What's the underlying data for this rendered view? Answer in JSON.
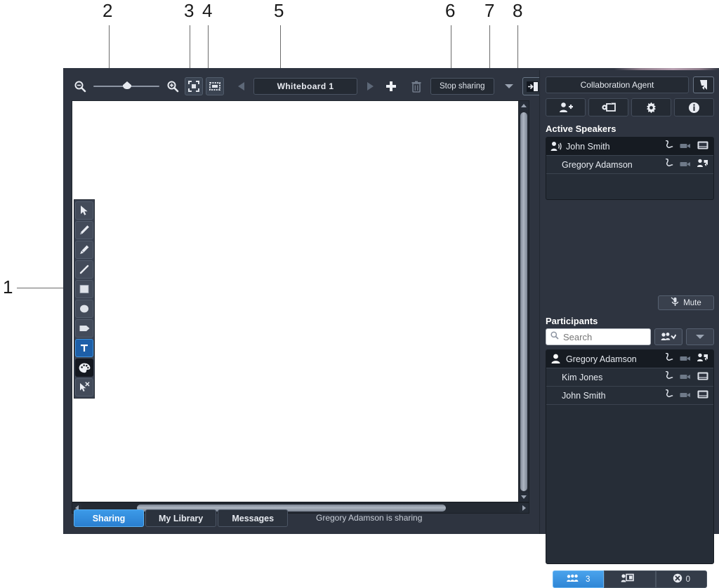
{
  "callouts": [
    {
      "num": "1"
    },
    {
      "num": "2"
    },
    {
      "num": "3"
    },
    {
      "num": "4"
    },
    {
      "num": "5"
    },
    {
      "num": "6"
    },
    {
      "num": "7"
    },
    {
      "num": "8"
    }
  ],
  "whiteboard_toolbar": {
    "zoom_out_icon": "magnifier-minus-icon",
    "zoom_in_icon": "magnifier-plus-icon",
    "fit_page_icon": "fit-to-page-icon",
    "fit_width_icon": "fit-to-width-icon",
    "prev_icon": "previous-page-icon",
    "next_icon": "next-page-icon",
    "add_icon": "add-page-icon",
    "delete_icon": "trash-icon",
    "title_value": "Whiteboard 1",
    "stop_sharing_label": "Stop sharing",
    "dropdown_icon": "chevron-down-icon",
    "dock_icon": "dock-panel-icon"
  },
  "tools": [
    {
      "name": "select-tool",
      "icon": "arrow-cursor-icon",
      "selected": false
    },
    {
      "name": "pencil-tool",
      "icon": "pencil-icon",
      "selected": false
    },
    {
      "name": "highlighter-tool",
      "icon": "marker-icon",
      "selected": false
    },
    {
      "name": "line-tool",
      "icon": "line-icon",
      "selected": false
    },
    {
      "name": "rectangle-tool",
      "icon": "rectangle-icon",
      "selected": false
    },
    {
      "name": "ellipse-tool",
      "icon": "ellipse-icon",
      "selected": false
    },
    {
      "name": "arrow-shape-tool",
      "icon": "arrow-shape-icon",
      "selected": false
    },
    {
      "name": "text-tool",
      "icon": "text-T-icon",
      "selected": true
    },
    {
      "name": "color-palette-tool",
      "icon": "palette-icon",
      "selected": false
    },
    {
      "name": "eraser-tool",
      "icon": "cursor-delete-icon",
      "selected": false
    }
  ],
  "bottom_tabs": {
    "items": [
      {
        "label": "Sharing",
        "active": true
      },
      {
        "label": "My Library",
        "active": false
      },
      {
        "label": "Messages",
        "active": false
      }
    ],
    "status": "Gregory Adamson is sharing"
  },
  "right_panel": {
    "title": "Collaboration Agent",
    "undock_icon": "undock-arrow-icon",
    "actions": [
      {
        "name": "add-participant-button",
        "icon": "person-plus-icon"
      },
      {
        "name": "share-screen-button",
        "icon": "share-settings-icon"
      },
      {
        "name": "settings-button",
        "icon": "gear-icon"
      },
      {
        "name": "info-button",
        "icon": "info-circle-icon"
      }
    ],
    "active_speakers": {
      "heading": "Active Speakers",
      "rows": [
        {
          "name": "John Smith",
          "highlighted": true,
          "avatar": "person-speaking-icon",
          "icons": [
            "phone-icon",
            "video-icon",
            "screen-icon"
          ]
        },
        {
          "name": "Gregory Adamson",
          "highlighted": false,
          "avatar": "",
          "icons": [
            "phone-icon",
            "video-icon",
            "person-share-icon"
          ]
        }
      ]
    },
    "mute": {
      "label": "Mute",
      "icon": "microphone-muted-icon"
    },
    "participants": {
      "heading": "Participants",
      "search_placeholder": "Search",
      "search_value": "",
      "search_icon": "search-icon",
      "invite_icon": "invite-people-icon",
      "dropdown_icon": "chevron-down-icon",
      "rows": [
        {
          "name": "Gregory Adamson",
          "highlighted": true,
          "avatar": "person-filled-icon",
          "icons": [
            "phone-icon",
            "video-icon",
            "person-share-icon"
          ]
        },
        {
          "name": "Kim Jones",
          "highlighted": false,
          "avatar": "",
          "icons": [
            "phone-icon",
            "video-icon",
            "screen-icon"
          ]
        },
        {
          "name": "John Smith",
          "highlighted": false,
          "avatar": "",
          "icons": [
            "phone-icon",
            "video-icon",
            "screen-icon"
          ]
        }
      ]
    },
    "bottom_bar": [
      {
        "name": "participants-count",
        "icon": "people-group-icon",
        "count": "3",
        "active": true
      },
      {
        "name": "waiting-room",
        "icon": "person-badge-icon",
        "count": "",
        "active": false
      },
      {
        "name": "blocked-count",
        "icon": "blocked-circle-icon",
        "count": "0",
        "active": false
      }
    ]
  },
  "colors": {
    "accent_blue": "#3c9ae8",
    "panel_bg": "#2e3440",
    "list_bg": "#262d37",
    "selected_row": "#161b22"
  }
}
